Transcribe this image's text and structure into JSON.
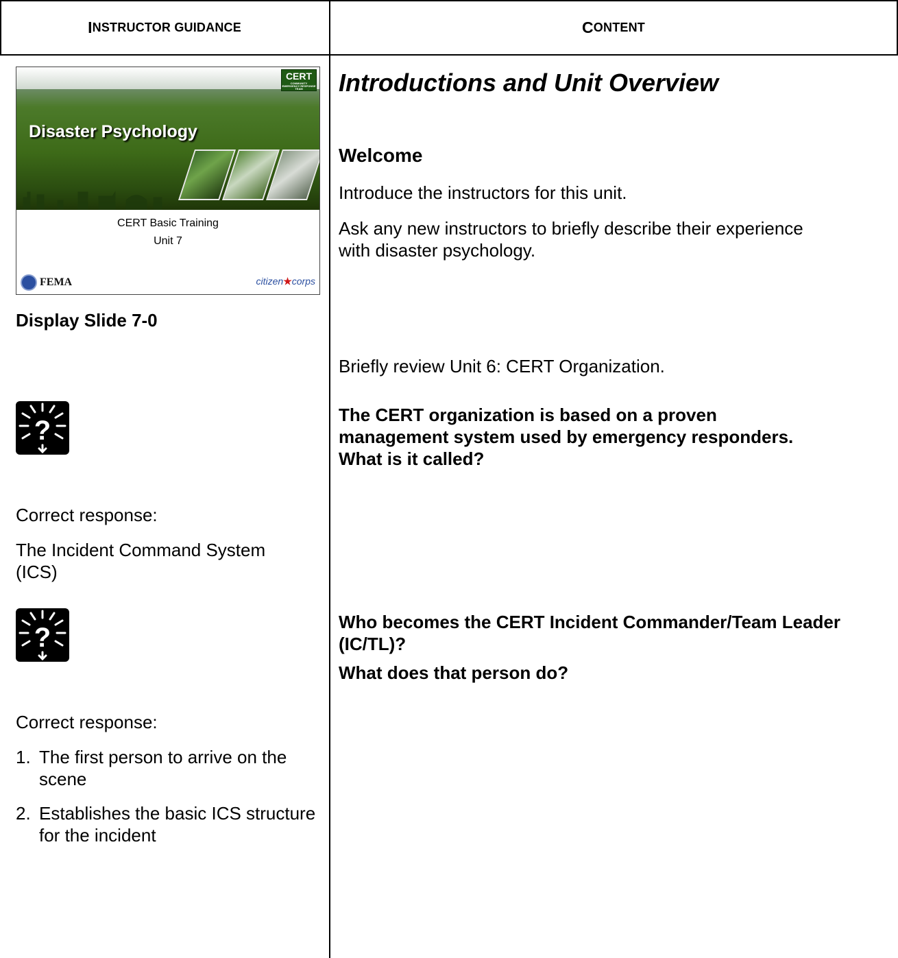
{
  "header": {
    "col1_first": "I",
    "col1_rest": "NSTRUCTOR GUIDANCE",
    "col2_first": "C",
    "col2_rest": "ONTENT"
  },
  "slide": {
    "title": "Disaster Psychology",
    "logo_text": "CERT",
    "logo_subtext": "COMMUNITY EMERGENCY RESPONSE TEAM",
    "subtitle_1": "CERT Basic Training",
    "subtitle_2": "Unit 7",
    "fema_label": "FEMA",
    "citizen_label": "citizen",
    "corps_label": "corps"
  },
  "guidance": {
    "display_slide": "Display Slide 7-0",
    "correct_response_1": "Correct response:",
    "answer_1": "The Incident Command System (ICS)",
    "correct_response_2": "Correct response:",
    "answers_2": [
      {
        "num": "1.",
        "text": "The first person to arrive on the scene"
      },
      {
        "num": "2.",
        "text": "Establishes the basic ICS structure for the incident"
      }
    ]
  },
  "content": {
    "section_title": "Introductions and Unit Overview",
    "welcome_heading": "Welcome",
    "welcome_p1": "Introduce the instructors for this unit.",
    "welcome_p2": "Ask any new instructors to briefly describe their experience with disaster psychology.",
    "review": "Briefly review Unit 6:  CERT Organization.",
    "question_1": "The CERT organization is based on a proven management system used by emergency responders.  What is it called?",
    "question_2": "Who becomes the CERT Incident Commander/Team Leader (IC/TL)?",
    "question_3": "What does that person do?"
  },
  "icons": {
    "question_icon": "question-burst-icon"
  }
}
